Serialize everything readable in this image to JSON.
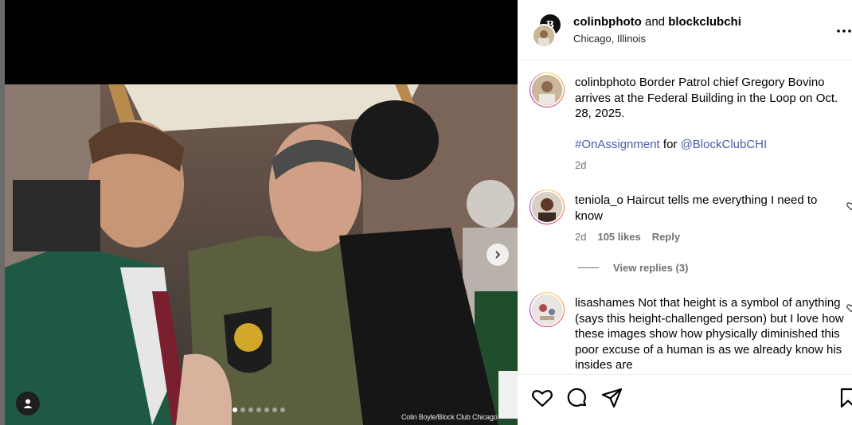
{
  "header": {
    "user1": "colinbphoto",
    "joiner": " and ",
    "user2": "blockclubchi",
    "location": "Chicago, Illinois",
    "more_icon": "more-icon"
  },
  "caption": {
    "username": "colinbphoto",
    "text": " Border Patrol chief Gregory Bovino arrives at the Federal Building in the Loop on Oct. 28, 2025.",
    "hashtag": "#OnAssignment",
    "for_word": " for ",
    "mention": "@BlockClubCHI",
    "time": "2d"
  },
  "comments": [
    {
      "username": "teniola_o",
      "text": " Haircut tells me everything I need to know",
      "time": "2d",
      "likes": "105 likes",
      "reply": "Reply",
      "view_replies": "View replies (3)"
    },
    {
      "username": "lisashames",
      "text": " Not that height is a symbol of anything (says this height-challenged person) but I love how these images show how physically diminished this poor excuse of a human is as we already know his insides are"
    }
  ],
  "photo": {
    "credit": "Colin Boyle/Block Club Chicago",
    "carousel_count": 7,
    "active_index": 0
  },
  "actions": [
    "heart-icon",
    "comment-icon",
    "share-icon",
    "bookmark-icon"
  ],
  "colors": {
    "link": "#4a5da8",
    "muted": "#737373"
  }
}
